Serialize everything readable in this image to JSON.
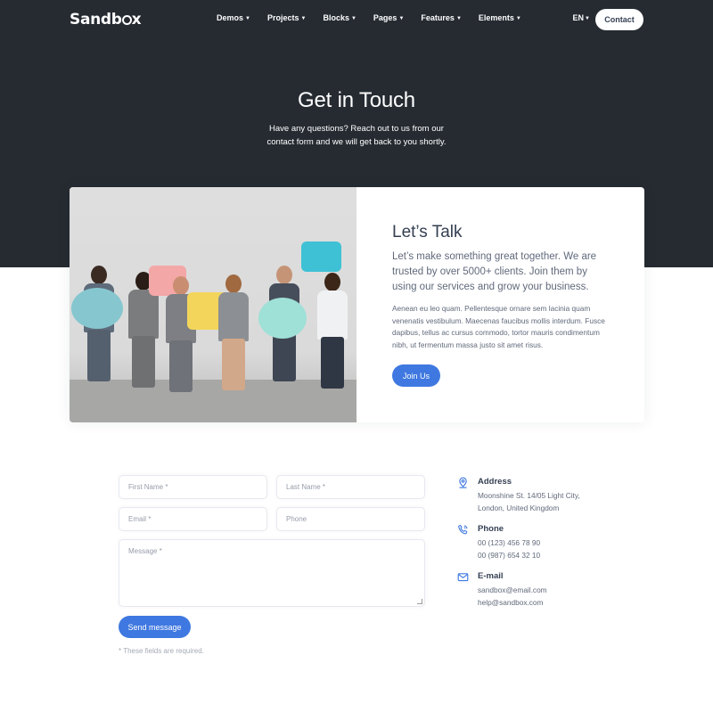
{
  "header": {
    "logo_text": "Sandbox",
    "menu": [
      {
        "label": "Demos"
      },
      {
        "label": "Projects"
      },
      {
        "label": "Blocks"
      },
      {
        "label": "Pages"
      },
      {
        "label": "Features"
      },
      {
        "label": "Elements"
      }
    ],
    "language": "EN",
    "contact_label": "Contact"
  },
  "hero": {
    "title": "Get in Touch",
    "subtitle": "Have any questions? Reach out to us from our contact form and we will get back to you shortly."
  },
  "about": {
    "title": "Let’s Talk",
    "lead": "Let’s make something great together. We are trusted by over 5000+ clients. Join them by using our services and grow your business.",
    "body": "Aenean eu leo quam. Pellentesque ornare sem lacinia quam venenatis vestibulum. Maecenas faucibus mollis interdum. Fusce dapibus, tellus ac cursus commodo, tortor mauris condimentum nibh, ut fermentum massa justo sit amet risus.",
    "button_label": "Join Us"
  },
  "form": {
    "first_name_placeholder": "First Name *",
    "last_name_placeholder": "Last Name *",
    "email_placeholder": "Email *",
    "phone_placeholder": "Phone",
    "message_placeholder": "Message *",
    "submit_label": "Send message",
    "required_note": "* These fields are required."
  },
  "contact_info": {
    "address": {
      "title": "Address",
      "line1": "Moonshine St. 14/05 Light City,",
      "line2": "London, United Kingdom",
      "icon": "location-pin-icon"
    },
    "phone": {
      "title": "Phone",
      "line1": "00 (123) 456 78 90",
      "line2": "00 (987) 654 32 10",
      "icon": "phone-icon"
    },
    "email": {
      "title": "E-mail",
      "line1": "sandbox@email.com",
      "line2": "help@sandbox.com",
      "icon": "envelope-icon"
    }
  },
  "colors": {
    "hero_bg": "#262b32",
    "primary": "#3f78e0",
    "heading": "#343f52",
    "body_text": "#60697b"
  }
}
